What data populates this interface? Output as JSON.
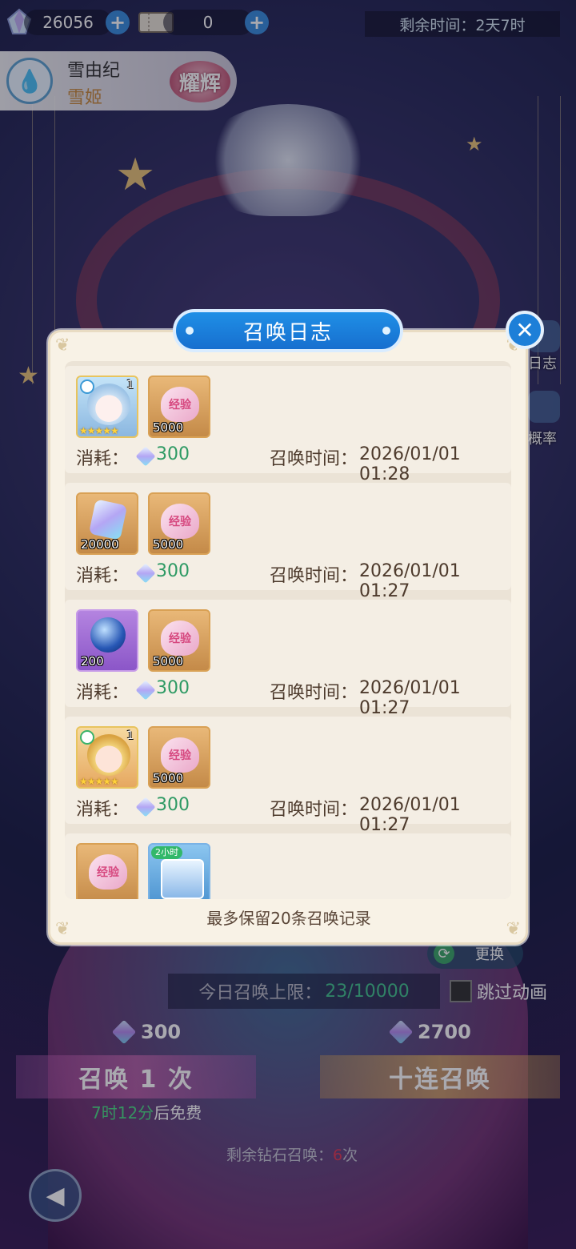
{
  "topbar": {
    "diamond_count": "26056",
    "ticket_count": "0",
    "remaining_time_label": "剩余时间：",
    "remaining_time_value": "2天7时"
  },
  "character": {
    "name": "雪由纪",
    "title": "雪姬",
    "rank": "耀辉"
  },
  "side": {
    "log_label": "日志",
    "rate_label": "概率"
  },
  "bottom": {
    "change_label": "更换",
    "daily_limit_label": "今日召唤上限：",
    "daily_limit_value": "23/10000",
    "skip_label": "跳过动画",
    "single_price": "300",
    "ten_price": "2700",
    "single_label": "召唤 1 次",
    "ten_label": "十连召唤",
    "free_time": "7时12分",
    "free_suffix": "后免费",
    "remain_diamond_label": "剩余钻石召唤：",
    "remain_diamond_count": "6",
    "remain_diamond_unit": "次"
  },
  "modal": {
    "title": "召唤日志",
    "footer": "最多保留20条召唤记录",
    "cost_label": "消耗：",
    "time_label": "召唤时间：",
    "records": [
      {
        "items": [
          {
            "icon": "character-snow-yuki-avatar",
            "level": "1",
            "stars": "★★★★★"
          },
          {
            "icon": "exp-heart-icon",
            "text": "经验",
            "qty": "5000"
          }
        ],
        "cost": "300",
        "time": "2026/01/01 01:28"
      },
      {
        "items": [
          {
            "icon": "diamond-icon",
            "qty": "20000"
          },
          {
            "icon": "exp-heart-icon",
            "text": "经验",
            "qty": "5000"
          }
        ],
        "cost": "300",
        "time": "2026/01/01 01:27"
      },
      {
        "items": [
          {
            "icon": "crystal-orb-icon",
            "qty": "200"
          },
          {
            "icon": "exp-heart-icon",
            "text": "经验",
            "qty": "5000"
          }
        ],
        "cost": "300",
        "time": "2026/01/01 01:27"
      },
      {
        "items": [
          {
            "icon": "character-blonde-avatar",
            "level": "1",
            "stars": "★★★★★"
          },
          {
            "icon": "exp-heart-icon",
            "text": "经验",
            "qty": "5000"
          }
        ],
        "cost": "300",
        "time": "2026/01/01 01:27"
      },
      {
        "items": [
          {
            "icon": "exp-heart-icon",
            "text": "经验"
          },
          {
            "icon": "treasure-chest-icon",
            "tag": "2小时"
          }
        ]
      }
    ]
  }
}
